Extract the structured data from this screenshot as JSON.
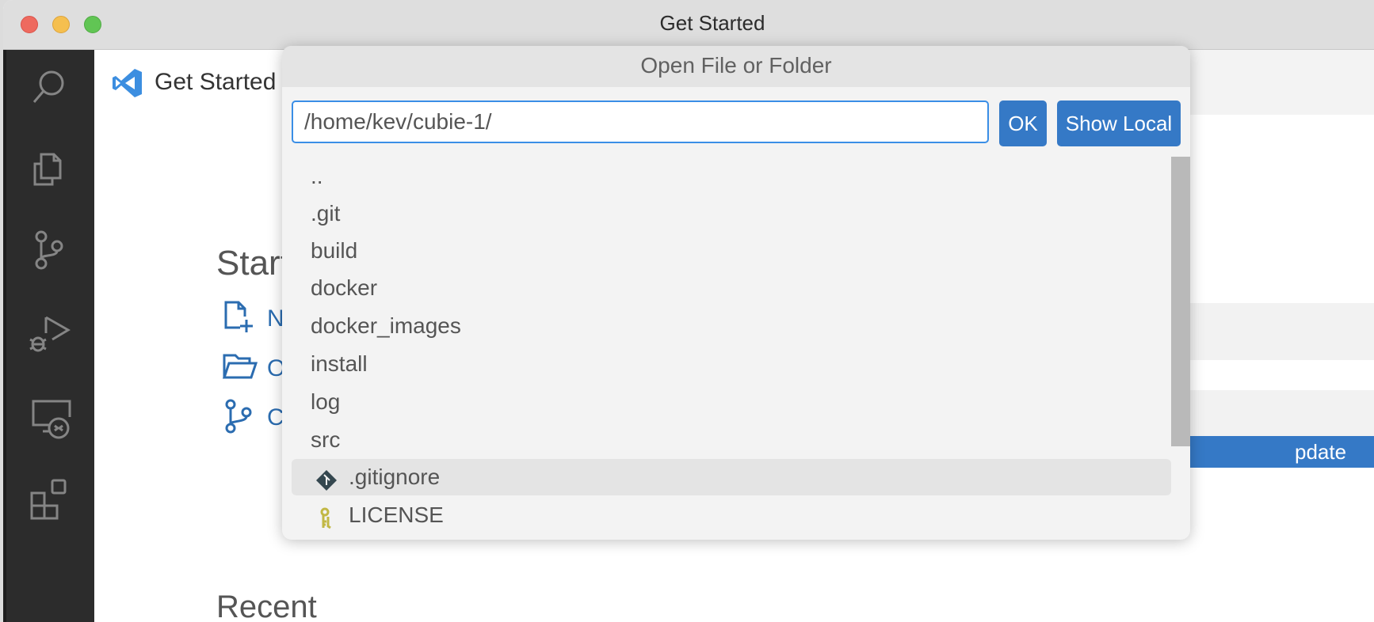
{
  "window": {
    "title": "Get Started"
  },
  "activity_bar": {
    "items": [
      {
        "name": "search",
        "icon": "search-icon"
      },
      {
        "name": "explorer",
        "icon": "files-icon"
      },
      {
        "name": "source-control",
        "icon": "source-control-icon"
      },
      {
        "name": "run-debug",
        "icon": "run-debug-icon"
      },
      {
        "name": "remote-explorer",
        "icon": "remote-explorer-icon"
      },
      {
        "name": "extensions",
        "icon": "extensions-icon"
      }
    ]
  },
  "tab": {
    "label": "Get Started",
    "close": "×"
  },
  "welcome": {
    "start_heading": "Start",
    "start_items": [
      {
        "label": "N",
        "icon": "new-file-icon"
      },
      {
        "label": "O",
        "icon": "folder-open-icon"
      },
      {
        "label": "C",
        "icon": "source-control-icon"
      }
    ],
    "recent_heading": "Recent",
    "update_button": "pdate"
  },
  "dialog": {
    "title": "Open File or Folder",
    "path_value": "/home/kev/cubie-1/",
    "ok_label": "OK",
    "show_local_label": "Show Local",
    "items": [
      {
        "label": "..",
        "type": "folder"
      },
      {
        "label": ".git",
        "type": "folder"
      },
      {
        "label": "build",
        "type": "folder"
      },
      {
        "label": "docker",
        "type": "folder"
      },
      {
        "label": "docker_images",
        "type": "folder"
      },
      {
        "label": "install",
        "type": "folder"
      },
      {
        "label": "log",
        "type": "folder"
      },
      {
        "label": "src",
        "type": "folder"
      },
      {
        "label": ".gitignore",
        "type": "file",
        "icon": "git-icon",
        "selected": true
      },
      {
        "label": "LICENSE",
        "type": "file",
        "icon": "license-key-icon"
      }
    ]
  },
  "colors": {
    "accent": "#3579c6",
    "focus_border": "#3a8ee6",
    "git_icon": "#34474f",
    "license_icon": "#c2b845"
  }
}
